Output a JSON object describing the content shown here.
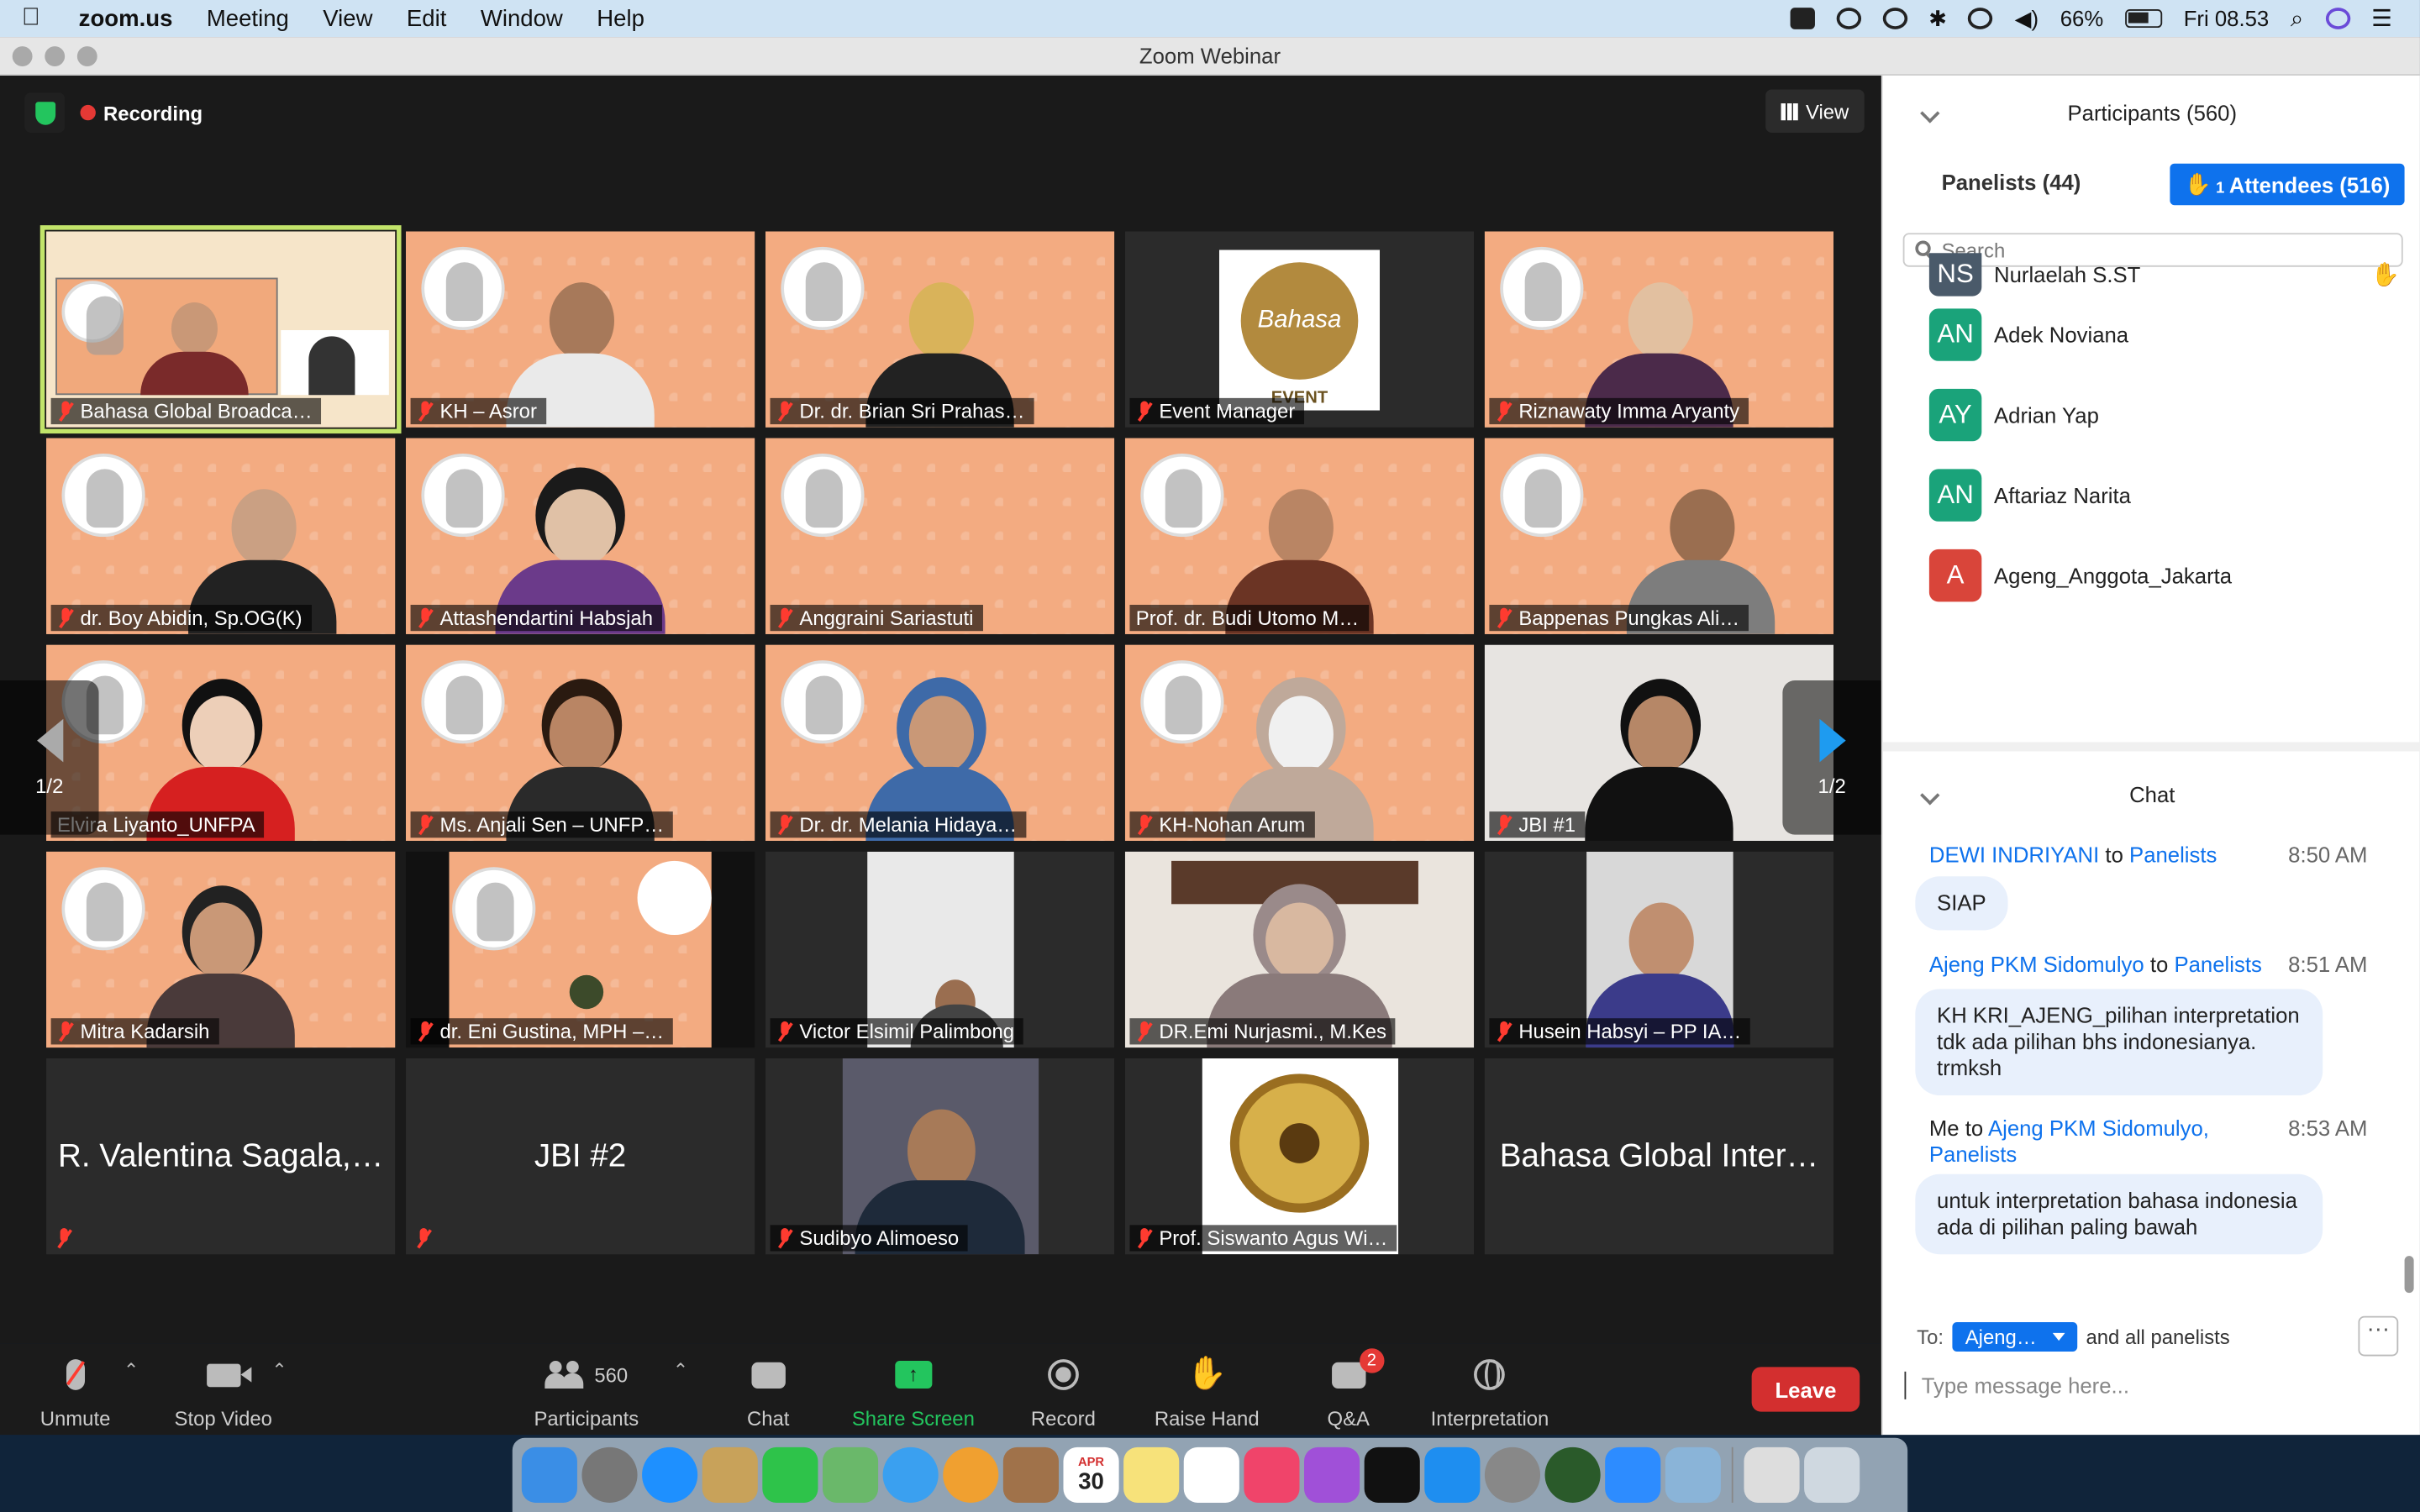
{
  "menubar": {
    "app": "zoom.us",
    "items": [
      "Meeting",
      "View",
      "Edit",
      "Window",
      "Help"
    ],
    "battery": "66%",
    "clock": "Fri 08.53"
  },
  "window": {
    "title": "Zoom Webinar"
  },
  "stage": {
    "recording_label": "Recording",
    "view_label": "View",
    "page_left": "1/2",
    "page_right": "1/2",
    "tiles": [
      {
        "name": "Bahasa Global Broadca…"
      },
      {
        "name": "KH – Asror"
      },
      {
        "name": "Dr. dr. Brian Sri Prahas…"
      },
      {
        "name": "Event Manager"
      },
      {
        "name": "Riznawaty Imma Aryanty"
      },
      {
        "name": "dr. Boy Abidin, Sp.OG(K)"
      },
      {
        "name": "Attashendartini Habsjah"
      },
      {
        "name": "Anggraini Sariastuti"
      },
      {
        "name": "Prof. dr. Budi Utomo M…"
      },
      {
        "name": "Bappenas Pungkas Ali…"
      },
      {
        "name": "Elvira Liyanto_UNFPA"
      },
      {
        "name": "Ms. Anjali Sen – UNFP…"
      },
      {
        "name": "Dr. dr. Melania Hidaya…"
      },
      {
        "name": "KH-Nohan Arum"
      },
      {
        "name": "JBI #1"
      },
      {
        "name": "Mitra Kadarsih"
      },
      {
        "name": "dr. Eni Gustina, MPH –…"
      },
      {
        "name": "Victor Elsimil Palimbong"
      },
      {
        "name": "DR.Emi Nurjasmi., M.Kes"
      },
      {
        "name": "Husein Habsyi – PP IA…"
      },
      {
        "name": "R. Valentina Sagala,…"
      },
      {
        "name": "JBI #2"
      },
      {
        "name": "Sudibyo Alimoeso"
      },
      {
        "name": "Prof. Siswanto Agus Wi…"
      },
      {
        "name": "Bahasa Global Inter…"
      }
    ],
    "event_logo_text": "Bahasa",
    "event_logo_sub": "EVENT"
  },
  "toolbar": {
    "unmute": "Unmute",
    "stop_video": "Stop Video",
    "participants": "Participants",
    "participants_count": "560",
    "chat": "Chat",
    "share": "Share Screen",
    "record": "Record",
    "raise_hand": "Raise Hand",
    "qa": "Q&A",
    "qa_badge": "2",
    "interpretation": "Interpretation",
    "leave": "Leave"
  },
  "participants": {
    "title": "Participants (560)",
    "tab_panelists": "Panelists (44)",
    "tab_attendees": "Attendees (516)",
    "tab_attendees_hand": "1",
    "search_placeholder": "Search",
    "list": [
      {
        "initials": "NS",
        "name": "Nurlaelah S.ST",
        "color": "#4a5a6a",
        "hand": true
      },
      {
        "initials": "AN",
        "name": "Adek Noviana",
        "color": "#1aa37a",
        "hand": false
      },
      {
        "initials": "AY",
        "name": "Adrian Yap",
        "color": "#1aa37a",
        "hand": false
      },
      {
        "initials": "AN",
        "name": "Aftariaz Narita",
        "color": "#1aa37a",
        "hand": false
      },
      {
        "initials": "A",
        "name": "Ageng_Anggota_Jakarta",
        "color": "#d9453a",
        "hand": false
      }
    ]
  },
  "chat": {
    "title": "Chat",
    "messages": [
      {
        "from": "DEWI INDRIYANI",
        "to_word": "to",
        "to": "Panelists",
        "time": "8:50 AM",
        "text": "SIAP"
      },
      {
        "from": "Ajeng PKM Sidomulyo",
        "to_word": "to",
        "to": "Panelists",
        "time": "8:51 AM",
        "text": "KH KRI_AJENG_pilihan interpretation tdk ada pilihan bhs indonesianya. trmksh"
      },
      {
        "from": "Me",
        "to_word": "to",
        "to": "Ajeng PKM Sidomulyo, Panelists",
        "time": "8:53 AM",
        "text": "untuk interpretation bahasa indonesia ada di pilihan paling bawah"
      }
    ],
    "to_label": "To:",
    "to_value": "Ajeng…",
    "to_suffix": "and all panelists",
    "more": "···",
    "input_placeholder": "Type message here..."
  },
  "dock": {
    "calendar_month": "APR",
    "calendar_day": "30"
  }
}
